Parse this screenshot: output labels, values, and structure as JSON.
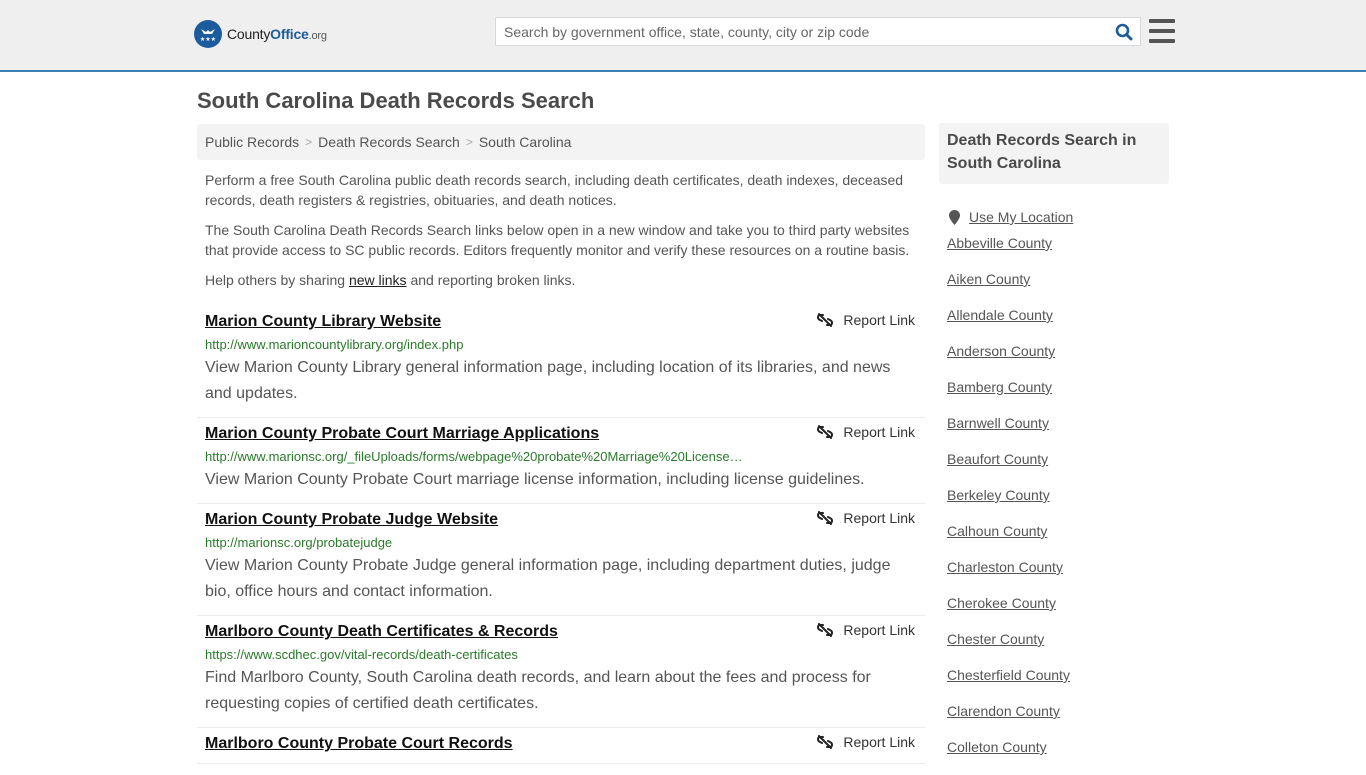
{
  "header": {
    "logo": {
      "brand_main": "County",
      "brand_accent": "Office",
      "brand_tld": ".org",
      "icon": "eagle-stars-logo-icon"
    },
    "search": {
      "placeholder": "Search by government office, state, county, city or zip code",
      "value": "",
      "icon": "search-icon"
    },
    "menu_icon": "hamburger-menu-icon"
  },
  "page": {
    "title": "South Carolina Death Records Search",
    "breadcrumb": [
      "Public Records",
      "Death Records Search",
      "South Carolina"
    ],
    "breadcrumb_separator": ">"
  },
  "intro": {
    "p1": "Perform a free South Carolina public death records search, including death certificates, death indexes, deceased records, death registers & registries, obituaries, and death notices.",
    "p2": "The South Carolina Death Records Search links below open in a new window and take you to third party websites that provide access to SC public records. Editors frequently monitor and verify these resources on a routine basis.",
    "p3_before": "Help others by sharing ",
    "p3_link": "new links",
    "p3_after": " and reporting broken links."
  },
  "results": [
    {
      "title": "Marion County Library Website",
      "url": "http://www.marioncountylibrary.org/index.php",
      "description": "View Marion County Library general information page, including location of its libraries, and news and updates.",
      "report_label": "Report Link"
    },
    {
      "title": "Marion County Probate Court Marriage Applications",
      "url": "http://www.marionsc.org/_fileUploads/forms/webpage%20probate%20Marriage%20License…",
      "description": "View Marion County Probate Court marriage license information, including license guidelines.",
      "report_label": "Report Link"
    },
    {
      "title": "Marion County Probate Judge Website",
      "url": "http://marionsc.org/probatejudge",
      "description": "View Marion County Probate Judge general information page, including department duties, judge bio, office hours and contact information.",
      "report_label": "Report Link"
    },
    {
      "title": "Marlboro County Death Certificates & Records",
      "url": "https://www.scdhec.gov/vital-records/death-certificates",
      "description": "Find Marlboro County, South Carolina death records, and learn about the fees and process for requesting copies of certified death certificates.",
      "report_label": "Report Link"
    },
    {
      "title": "Marlboro County Probate Court Records",
      "url": "",
      "description": "",
      "report_label": "Report Link"
    }
  ],
  "sidebar": {
    "heading": "Death Records Search in South Carolina",
    "use_location": "Use My Location",
    "counties": [
      "Abbeville County",
      "Aiken County",
      "Allendale County",
      "Anderson County",
      "Bamberg County",
      "Barnwell County",
      "Beaufort County",
      "Berkeley County",
      "Calhoun County",
      "Charleston County",
      "Cherokee County",
      "Chester County",
      "Chesterfield County",
      "Clarendon County",
      "Colleton County"
    ]
  },
  "colors": {
    "brand_blue": "#1d5c9c",
    "header_border": "#3a7fb0",
    "url_green": "#2a7a2a",
    "header_bg": "#efefef"
  }
}
